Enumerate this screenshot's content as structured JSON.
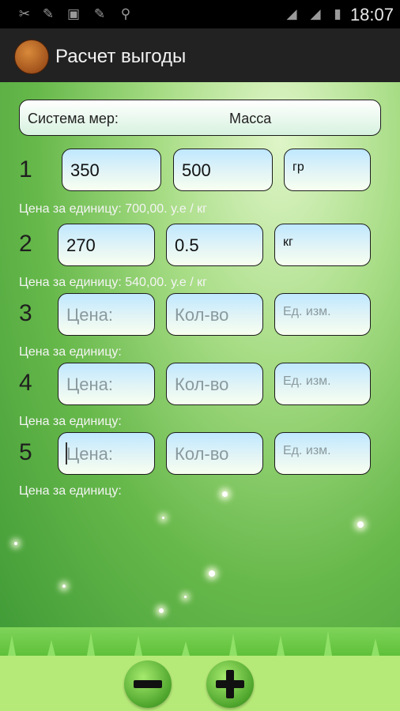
{
  "status_bar": {
    "time": "18:07"
  },
  "action_bar": {
    "title": "Расчет выгоды"
  },
  "measure_system": {
    "label": "Система мер:",
    "value": "Масса"
  },
  "rows": [
    {
      "number": "1",
      "price": "350",
      "quantity": "500",
      "unit": "гр",
      "price_placeholder": "Цена:",
      "qty_placeholder": "Кол-во",
      "unit_placeholder": "Ед. изм.",
      "unit_price": "Цена за единицу: 700,00. у.е / кг"
    },
    {
      "number": "2",
      "price": "270",
      "quantity": "0.5",
      "unit": "кг",
      "price_placeholder": "Цена:",
      "qty_placeholder": "Кол-во",
      "unit_placeholder": "Ед. изм.",
      "unit_price": "Цена за единицу: 540,00. у.е / кг"
    },
    {
      "number": "3",
      "price": "",
      "quantity": "",
      "unit": "",
      "price_placeholder": "Цена:",
      "qty_placeholder": "Кол-во",
      "unit_placeholder": "Ед. изм.",
      "unit_price": "Цена за единицу:"
    },
    {
      "number": "4",
      "price": "",
      "quantity": "",
      "unit": "",
      "price_placeholder": "Цена:",
      "qty_placeholder": "Кол-во",
      "unit_placeholder": "Ед. изм.",
      "unit_price": "Цена за единицу:"
    },
    {
      "number": "5",
      "price": "",
      "quantity": "",
      "unit": "",
      "price_placeholder": "Цена:",
      "qty_placeholder": "Кол-во",
      "unit_placeholder": "Ед. изм.",
      "unit_price": "Цена за единицу:"
    }
  ],
  "colors": {
    "statusbar": "#000000",
    "actionbar": "#222222",
    "bottom_bar": "#b6ea78",
    "button_green": "#4ea52c"
  },
  "icons": [
    "screenshot-icon",
    "clean-icon",
    "image-icon",
    "clean-icon",
    "usb-icon",
    "signal-icon",
    "signal-icon",
    "battery-icon",
    "app-icon",
    "minus-icon",
    "plus-icon"
  ]
}
